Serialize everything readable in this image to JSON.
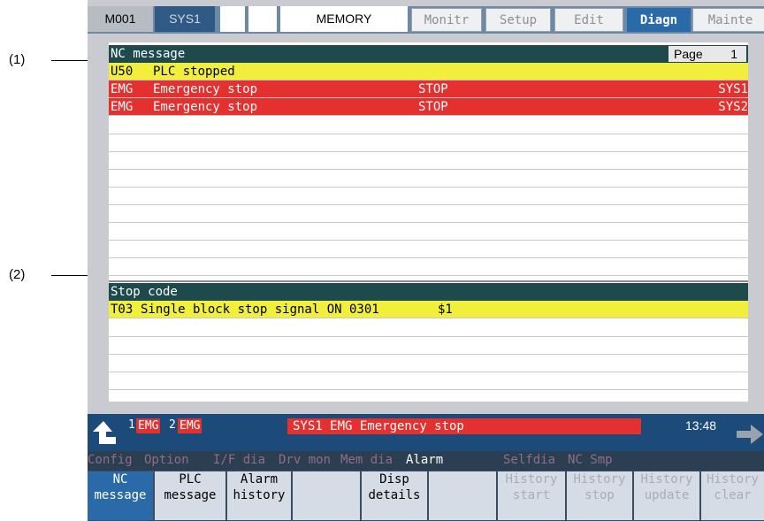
{
  "annotations": {
    "label1": "(1)",
    "label2": "(2)"
  },
  "topbar": {
    "cells": [
      "M001",
      "SYS1",
      "",
      "",
      "MEMORY"
    ],
    "tabs": [
      "Monitr",
      "Setup",
      "Edit",
      "Diagn",
      "Mainte"
    ],
    "active_tab": "Diagn"
  },
  "nc_message": {
    "title": "NC message",
    "page_label": "Page",
    "page_num": "1",
    "rows": [
      {
        "code": "U50",
        "text": "PLC stopped",
        "mid": "",
        "sys": ""
      },
      {
        "code": "EMG",
        "text": "Emergency stop",
        "mid": "STOP",
        "sys": "SYS1"
      },
      {
        "code": "EMG",
        "text": "Emergency stop",
        "mid": "STOP",
        "sys": "SYS2"
      }
    ]
  },
  "stop_code": {
    "title": "Stop code",
    "row": {
      "code": "T03",
      "text": "Single block stop signal ON 0301",
      "sys": "$1"
    }
  },
  "status": {
    "sys1_num": "1",
    "sys1_emg": "EMG",
    "sys2_num": "2",
    "sys2_emg": "EMG",
    "message": "SYS1 EMG  Emergency stop",
    "time": "13:48"
  },
  "ticker": {
    "items": [
      "Config",
      "Option",
      "I/F dia",
      "Drv mon",
      "Mem dia",
      "Alarm",
      "Selfdia",
      "NC Smp"
    ],
    "highlight": "Alarm"
  },
  "softkeys": [
    {
      "line1": "NC",
      "line2": "message",
      "state": "active"
    },
    {
      "line1": "PLC",
      "line2": "message",
      "state": "normal"
    },
    {
      "line1": "Alarm",
      "line2": "history",
      "state": "normal"
    },
    {
      "line1": "",
      "line2": "",
      "state": "normal"
    },
    {
      "line1": "Disp",
      "line2": "details",
      "state": "normal"
    },
    {
      "line1": "",
      "line2": "",
      "state": "normal"
    },
    {
      "line1": "History",
      "line2": "start",
      "state": "disabled"
    },
    {
      "line1": "History",
      "line2": "stop",
      "state": "disabled"
    },
    {
      "line1": "History",
      "line2": "update",
      "state": "disabled"
    },
    {
      "line1": "History",
      "line2": "clear",
      "state": "disabled"
    }
  ],
  "colors": {
    "header": "#1e4a4e",
    "yellow": "#f2ee3c",
    "red": "#e53030",
    "active_tab": "#2a6aa8"
  }
}
